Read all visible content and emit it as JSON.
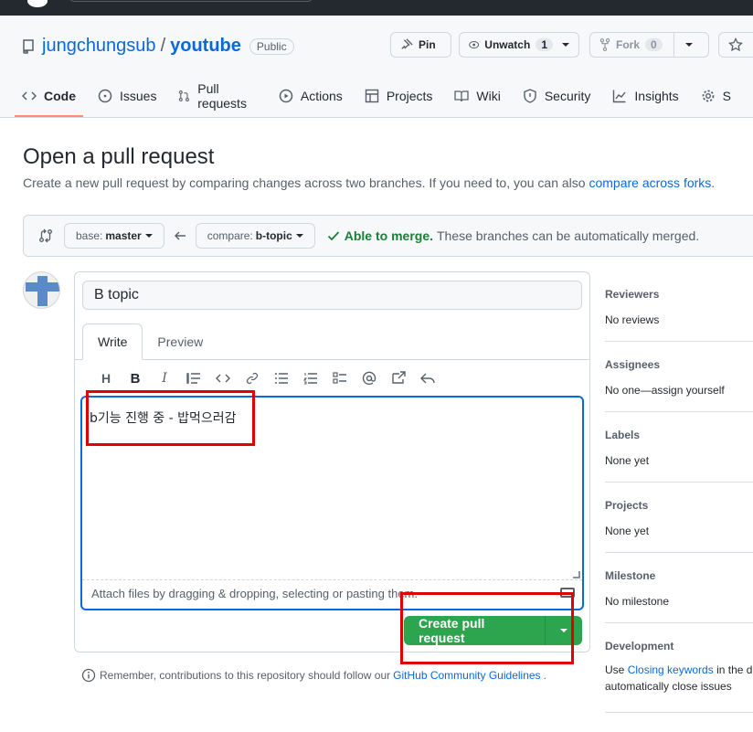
{
  "repo": {
    "owner": "jungchungsub",
    "separator": "/",
    "name": "youtube",
    "visibility": "Public"
  },
  "actions": {
    "pin": "Pin",
    "watch": "Unwatch",
    "watch_count": "1",
    "fork": "Fork",
    "fork_count": "0"
  },
  "tabs": [
    "Code",
    "Issues",
    "Pull requests",
    "Actions",
    "Projects",
    "Wiki",
    "Security",
    "Insights",
    "S"
  ],
  "page": {
    "title": "Open a pull request",
    "subtitle": "Create a new pull request by comparing changes across two branches. If you need to, you can also",
    "subtitle_link": "compare across forks",
    "subtitle_end": "."
  },
  "range": {
    "base_label": "base:",
    "base_branch": "master",
    "compare_label": "compare:",
    "compare_branch": "b-topic",
    "merge_status": "Able to merge.",
    "merge_detail": "These branches can be automatically merged."
  },
  "form": {
    "title_value": "B topic",
    "tab_write": "Write",
    "tab_preview": "Preview",
    "body_text": "b기능 진행 중 - 밥먹으러감",
    "attach_text": "Attach files by dragging & dropping, selecting or pasting them.",
    "create_button": "Create pull request"
  },
  "toolbar": [
    "H",
    "B",
    "I"
  ],
  "note": {
    "prefix": "Remember, contributions to this repository should follow our",
    "link": "GitHub Community Guidelines",
    "suffix": "."
  },
  "sidebar": {
    "reviewers": {
      "heading": "Reviewers",
      "value": "No reviews"
    },
    "assignees": {
      "heading": "Assignees",
      "value": "No one—assign yourself"
    },
    "labels": {
      "heading": "Labels",
      "value": "None yet"
    },
    "projects": {
      "heading": "Projects",
      "value": "None yet"
    },
    "milestone": {
      "heading": "Milestone",
      "value": "No milestone"
    },
    "development": {
      "heading": "Development",
      "value_prefix": "Use",
      "value_link": "Closing keywords",
      "value_suffix": "in the de",
      "value_line2": "automatically close issues"
    }
  },
  "colors": {
    "accent": "#0969da",
    "success": "#2da44e",
    "highlight": "#e00000",
    "tab_underline": "#fd8c73"
  }
}
